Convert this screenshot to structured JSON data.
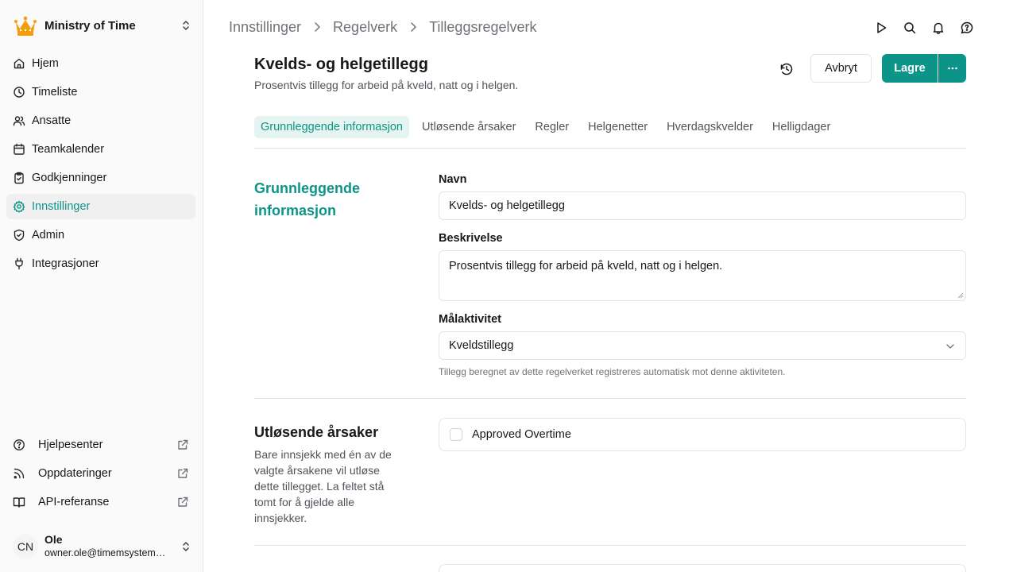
{
  "sidebar": {
    "org_name": "Ministry of Time",
    "nav_items": [
      {
        "label": "Hjem",
        "icon": "home-icon"
      },
      {
        "label": "Timeliste",
        "icon": "clock-icon"
      },
      {
        "label": "Ansatte",
        "icon": "users-icon"
      },
      {
        "label": "Teamkalender",
        "icon": "calendar-icon"
      },
      {
        "label": "Godkjenninger",
        "icon": "clipboard-check-icon"
      },
      {
        "label": "Innstillinger",
        "icon": "gear-icon",
        "active": true
      },
      {
        "label": "Admin",
        "icon": "shield-check-icon"
      },
      {
        "label": "Integrasjoner",
        "icon": "plug-icon"
      }
    ],
    "bottom_items": [
      {
        "label": "Hjelpesenter",
        "icon": "help-circle-icon"
      },
      {
        "label": "Oppdateringer",
        "icon": "rss-icon"
      },
      {
        "label": "API-referanse",
        "icon": "book-icon"
      }
    ],
    "user": {
      "initials": "CN",
      "name": "Ole",
      "email": "owner.ole@timemsystem.com"
    }
  },
  "breadcrumb": [
    "Innstillinger",
    "Regelverk",
    "Tilleggsregelverk"
  ],
  "page": {
    "title": "Kvelds- og helgetillegg",
    "subtitle": "Prosentvis tillegg for arbeid på kveld, natt og i helgen.",
    "cancel_label": "Avbryt",
    "save_label": "Lagre",
    "more_label": "···"
  },
  "tabs": [
    {
      "label": "Grunnleggende informasjon",
      "active": true
    },
    {
      "label": "Utløsende årsaker"
    },
    {
      "label": "Regler"
    },
    {
      "label": "Helgenetter"
    },
    {
      "label": "Hverdagskvelder"
    },
    {
      "label": "Helligdager"
    }
  ],
  "basic_info": {
    "section_title": "Grunnleggende informasjon",
    "name_label": "Navn",
    "name_value": "Kvelds- og helgetillegg",
    "description_label": "Beskrivelse",
    "description_value": "Prosentvis tillegg for arbeid på kveld, natt og i helgen.",
    "activity_label": "Målaktivitet",
    "activity_value": "Kveldstillegg",
    "activity_help": "Tillegg beregnet av dette regelverket registreres automatisk mot denne aktiviteten."
  },
  "triggers": {
    "section_title": "Utløsende årsaker",
    "description": "Bare innsjekk med én av de valgte årsakene vil utløse dette tillegget. La feltet stå tomt for å gjelde alle innsjekker.",
    "options": [
      {
        "label": "Approved Overtime",
        "checked": false
      }
    ]
  },
  "colors": {
    "accent": "#0d9488",
    "active_tab_bg": "#e6f4f1",
    "sidebar_bg": "#fafafa",
    "logo": "#f59e0b"
  }
}
